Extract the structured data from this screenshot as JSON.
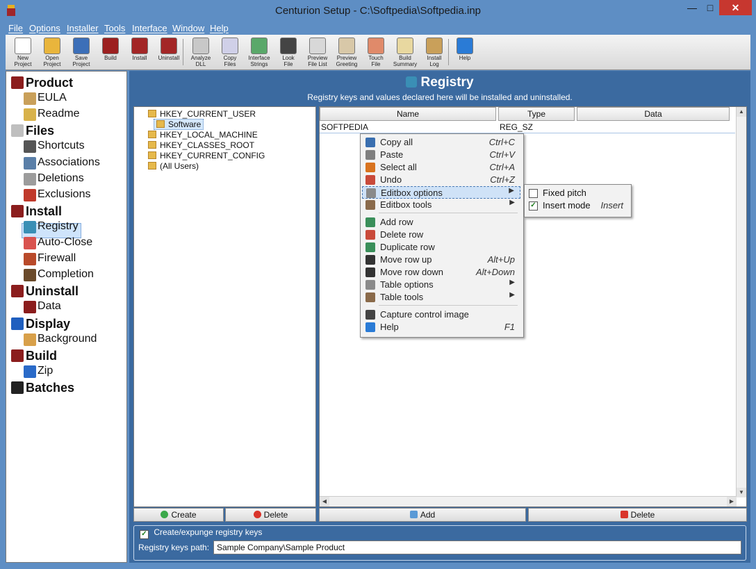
{
  "window": {
    "title": "Centurion Setup - C:\\Softpedia\\Softpedia.inp"
  },
  "menu": [
    "File",
    "Options",
    "Installer",
    "Tools",
    "Interface",
    "Window",
    "Help"
  ],
  "toolbar": [
    {
      "l1": "New",
      "l2": "Project",
      "color": "#ffffff"
    },
    {
      "l1": "Open",
      "l2": "Project",
      "color": "#e9b53c"
    },
    {
      "l1": "Save",
      "l2": "Project",
      "color": "#3c6fb8"
    },
    {
      "l1": "Build",
      "l2": "",
      "color": "#9c2020"
    },
    {
      "l1": "Install",
      "l2": "",
      "color": "#a32626"
    },
    {
      "l1": "Uninstall",
      "l2": "",
      "color": "#a32626"
    },
    {
      "l1": "Analyze",
      "l2": "DLL",
      "color": "#c8c8c8"
    },
    {
      "l1": "Copy",
      "l2": "Files",
      "color": "#d0d0e8"
    },
    {
      "l1": "Interface",
      "l2": "Strings",
      "color": "#5aa86a"
    },
    {
      "l1": "Look",
      "l2": "File",
      "color": "#444444"
    },
    {
      "l1": "Preview",
      "l2": "File List",
      "color": "#d8d8d8"
    },
    {
      "l1": "Preview",
      "l2": "Greeting",
      "color": "#d8c8a8"
    },
    {
      "l1": "Touch",
      "l2": "File",
      "color": "#e08a6a"
    },
    {
      "l1": "Build",
      "l2": "Summary",
      "color": "#e8d8a0"
    },
    {
      "l1": "Install",
      "l2": "Log",
      "color": "#c9a05a"
    },
    {
      "l1": "Help",
      "l2": "",
      "color": "#2a7bd6"
    }
  ],
  "sidebar": {
    "items": [
      {
        "label": "Product",
        "kind": "cat",
        "color": "#8b1d1d"
      },
      {
        "label": "EULA",
        "kind": "sub",
        "color": "#c9a05a"
      },
      {
        "label": "Readme",
        "kind": "sub",
        "color": "#d8b24a"
      },
      {
        "label": "Files",
        "kind": "cat",
        "color": "#bfbfbf"
      },
      {
        "label": "Shortcuts",
        "kind": "sub",
        "color": "#555555"
      },
      {
        "label": "Associations",
        "kind": "sub",
        "color": "#5a7fa8"
      },
      {
        "label": "Deletions",
        "kind": "sub",
        "color": "#9c9c9c"
      },
      {
        "label": "Exclusions",
        "kind": "sub",
        "color": "#c0392b"
      },
      {
        "label": "Install",
        "kind": "cat",
        "color": "#8b1d1d"
      },
      {
        "label": "Registry",
        "kind": "sub",
        "color": "#3a8fb5"
      },
      {
        "label": "Auto-Close",
        "kind": "sub",
        "color": "#d9534f"
      },
      {
        "label": "Firewall",
        "kind": "sub",
        "color": "#b94a2a"
      },
      {
        "label": "Completion",
        "kind": "sub",
        "color": "#6a4a2a"
      },
      {
        "label": "Uninstall",
        "kind": "cat",
        "color": "#8b1d1d"
      },
      {
        "label": "Data",
        "kind": "sub",
        "color": "#8b1d1d"
      },
      {
        "label": "Display",
        "kind": "cat",
        "color": "#1f5fbf"
      },
      {
        "label": "Background",
        "kind": "sub",
        "color": "#d8a04a"
      },
      {
        "label": "Build",
        "kind": "cat",
        "color": "#8b1d1d"
      },
      {
        "label": "Zip",
        "kind": "sub",
        "color": "#2a6ac8"
      },
      {
        "label": "Batches",
        "kind": "cat",
        "color": "#222222"
      }
    ],
    "selected": "Registry"
  },
  "header": {
    "title": "Registry",
    "subtitle": "Registry keys and values declared here will be installed and uninstalled."
  },
  "tree": {
    "nodes": [
      {
        "label": "HKEY_CURRENT_USER",
        "level": 0
      },
      {
        "label": "Software",
        "level": 1,
        "selected": true
      },
      {
        "label": "HKEY_LOCAL_MACHINE",
        "level": 0
      },
      {
        "label": "HKEY_CLASSES_ROOT",
        "level": 0
      },
      {
        "label": "HKEY_CURRENT_CONFIG",
        "level": 0
      },
      {
        "label": "(All Users)",
        "level": 0
      }
    ]
  },
  "grid": {
    "columns": [
      "Name",
      "Type",
      "Data"
    ],
    "rows": [
      [
        "SOFTPEDIA",
        "REG_SZ",
        ""
      ]
    ]
  },
  "buttons": {
    "create": "Create",
    "delete_left": "Delete",
    "add": "Add",
    "delete_right": "Delete"
  },
  "bottom": {
    "checkbox_label": "Create/expunge registry keys",
    "path_label": "Registry keys path:",
    "path_value": "Sample Company\\Sample Product"
  },
  "context_menu": {
    "groups": [
      [
        {
          "label": "Copy all",
          "shortcut": "Ctrl+C",
          "color": "#3a6fb0"
        },
        {
          "label": "Paste",
          "shortcut": "Ctrl+V",
          "color": "#7f7f7f"
        },
        {
          "label": "Select all",
          "shortcut": "Ctrl+A",
          "color": "#d8731f"
        },
        {
          "label": "Undo",
          "shortcut": "Ctrl+Z",
          "color": "#c94a3a"
        },
        {
          "label": "Editbox options",
          "shortcut": "",
          "submenu": true,
          "highlighted": true,
          "color": "#8a8a8a"
        },
        {
          "label": "Editbox tools",
          "shortcut": "",
          "submenu": true,
          "color": "#8a6a4a"
        }
      ],
      [
        {
          "label": "Add row",
          "shortcut": "",
          "color": "#3a8f5a"
        },
        {
          "label": "Delete row",
          "shortcut": "",
          "color": "#c94a3a"
        },
        {
          "label": "Duplicate row",
          "shortcut": "",
          "color": "#3a8f5a"
        },
        {
          "label": "Move row up",
          "shortcut": "Alt+Up",
          "color": "#333333"
        },
        {
          "label": "Move row down",
          "shortcut": "Alt+Down",
          "color": "#333333"
        },
        {
          "label": "Table options",
          "shortcut": "",
          "submenu": true,
          "color": "#8a8a8a"
        },
        {
          "label": "Table tools",
          "shortcut": "",
          "submenu": true,
          "color": "#8a6a4a"
        }
      ],
      [
        {
          "label": "Capture control image",
          "shortcut": "",
          "color": "#444444"
        },
        {
          "label": "Help",
          "shortcut": "F1",
          "color": "#2a7bd6"
        }
      ]
    ]
  },
  "submenu": {
    "items": [
      {
        "label": "Fixed pitch",
        "shortcut": "",
        "checked": false
      },
      {
        "label": "Insert mode",
        "shortcut": "Insert",
        "checked": true
      }
    ]
  }
}
